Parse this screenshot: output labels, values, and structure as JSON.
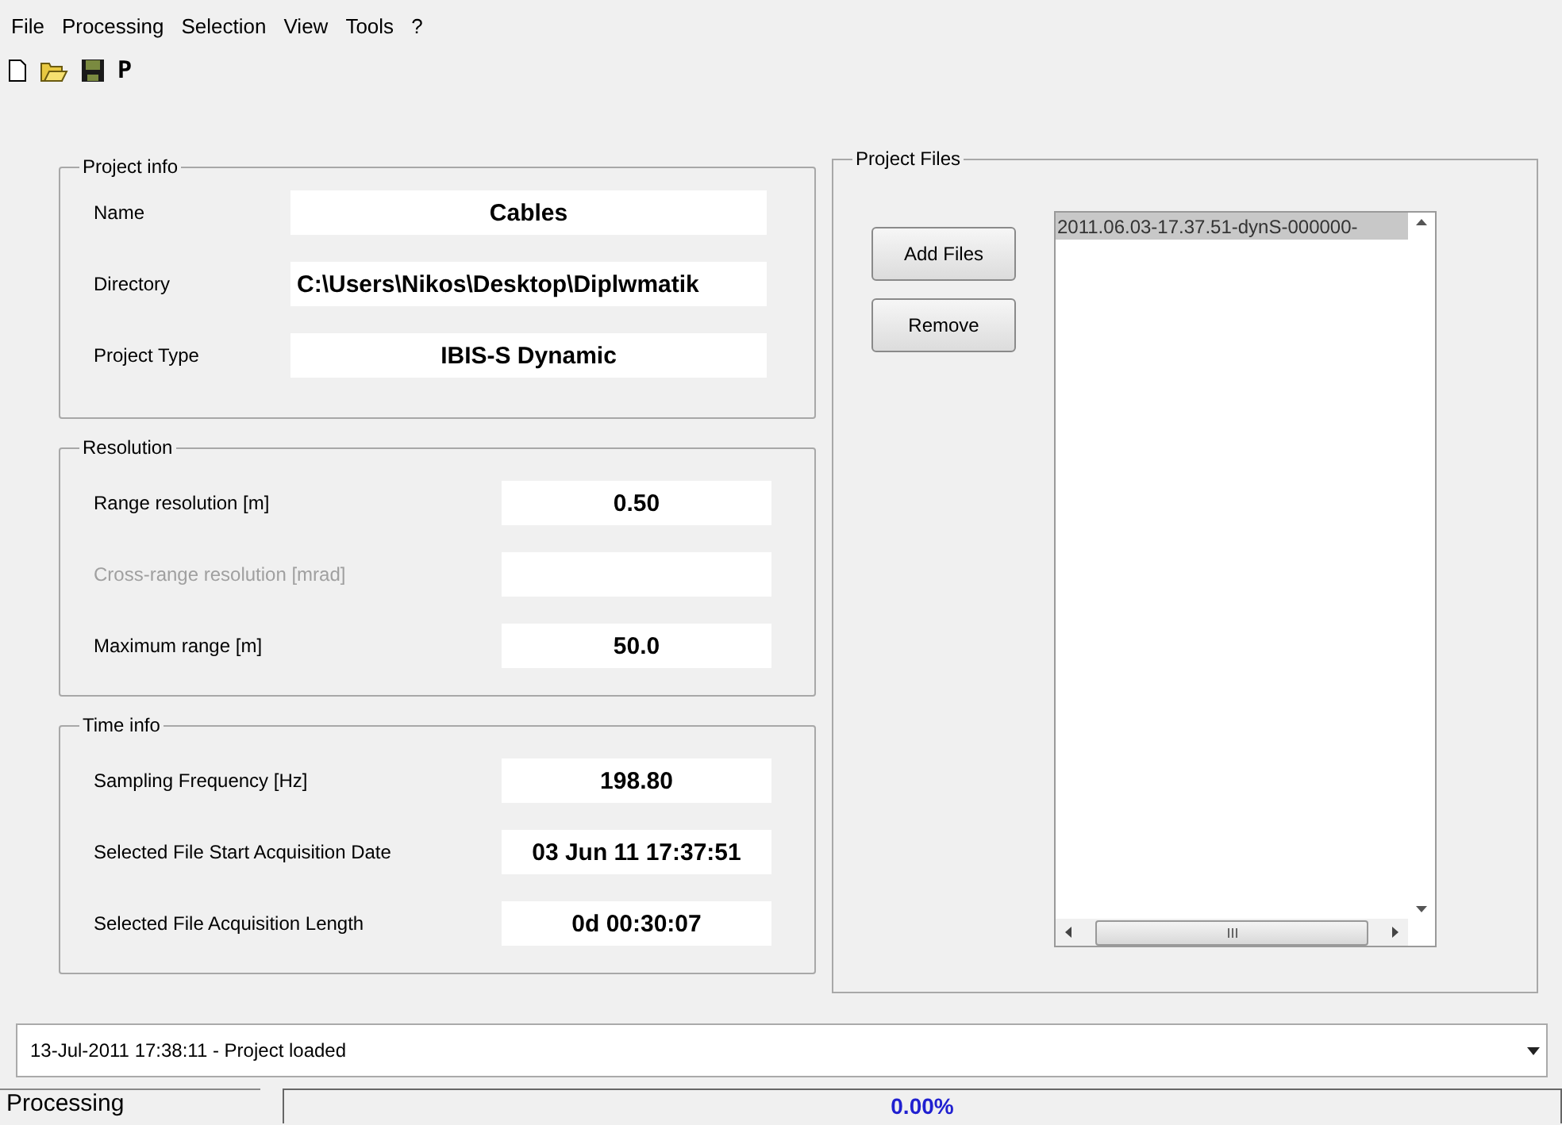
{
  "menu": [
    "File",
    "Processing",
    "Selection",
    "View",
    "Tools",
    "?"
  ],
  "toolbar": [
    {
      "kind": "new"
    },
    {
      "kind": "open"
    },
    {
      "kind": "save"
    },
    {
      "kind": "letter",
      "label": "P"
    }
  ],
  "project_info": {
    "title": "Project info",
    "fields": [
      {
        "label": "Name",
        "value": "Cables"
      },
      {
        "label": "Directory",
        "value": "C:\\Users\\Nikos\\Desktop\\Diplwmatik"
      },
      {
        "label": "Project Type",
        "value": "IBIS-S Dynamic"
      }
    ]
  },
  "resolution": {
    "title": "Resolution",
    "fields": [
      {
        "label": "Range resolution [m]",
        "value": "0.50",
        "disabled": false
      },
      {
        "label": "Cross-range resolution [mrad]",
        "disabled": true
      },
      {
        "label": "Maximum range [m]",
        "value": "50.0",
        "disabled": false
      }
    ]
  },
  "time_info": {
    "title": "Time info",
    "fields": [
      {
        "label": "Sampling Frequency [Hz]",
        "value": "198.80"
      },
      {
        "label": "Selected File Start Acquisition Date",
        "value": "03 Jun 11  17:37:51"
      },
      {
        "label": "Selected File Acquisition Length",
        "value": "0d  00:30:07"
      }
    ]
  },
  "project_files": {
    "title": "Project Files",
    "buttons": [
      "Add Files",
      "Remove"
    ],
    "files": [
      {
        "name": "2011.06.03-17.37.51-dynS-000000-",
        "selected": true
      }
    ]
  },
  "log": {
    "value": "13-Jul-2011 17:38:11 - Project loaded"
  },
  "status": {
    "label": "Processing",
    "reading": "0.00%"
  }
}
